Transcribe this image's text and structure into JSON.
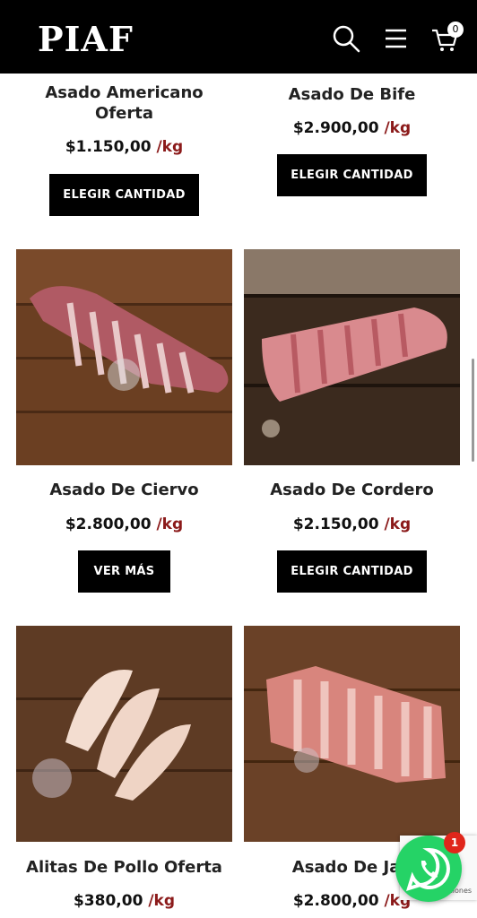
{
  "header": {
    "logo_text": "PIAF",
    "cart_count": "0",
    "icons": [
      "search-icon",
      "menu-icon",
      "cart-icon"
    ],
    "background": "#000000"
  },
  "products": [
    {
      "title": "Asado Americano Oferta",
      "price": "$1.150,00",
      "unit": "/kg",
      "button": "ELEGIR CANTIDAD"
    },
    {
      "title": "Asado De Bife",
      "price": "$2.900,00",
      "unit": "/kg",
      "button": "ELEGIR CANTIDAD"
    },
    {
      "title": "Asado De Ciervo",
      "price": "$2.800,00",
      "unit": "/kg",
      "button": "VER MÁS"
    },
    {
      "title": "Asado De Cordero",
      "price": "$2.150,00",
      "unit": "/kg",
      "button": "ELEGIR CANTIDAD"
    },
    {
      "title": "Alitas De Pollo Oferta",
      "price": "$380,00",
      "unit": "/kg"
    },
    {
      "title": "Asado De Jab",
      "price": "$2.800,00",
      "unit": "/kg"
    }
  ],
  "whatsapp": {
    "badge": "1",
    "icon": "whatsapp-icon",
    "color": "#25d366"
  },
  "recaptcha": {
    "text": "cciones"
  },
  "colors": {
    "unit": "#8b1a1a",
    "button": "#000000"
  }
}
